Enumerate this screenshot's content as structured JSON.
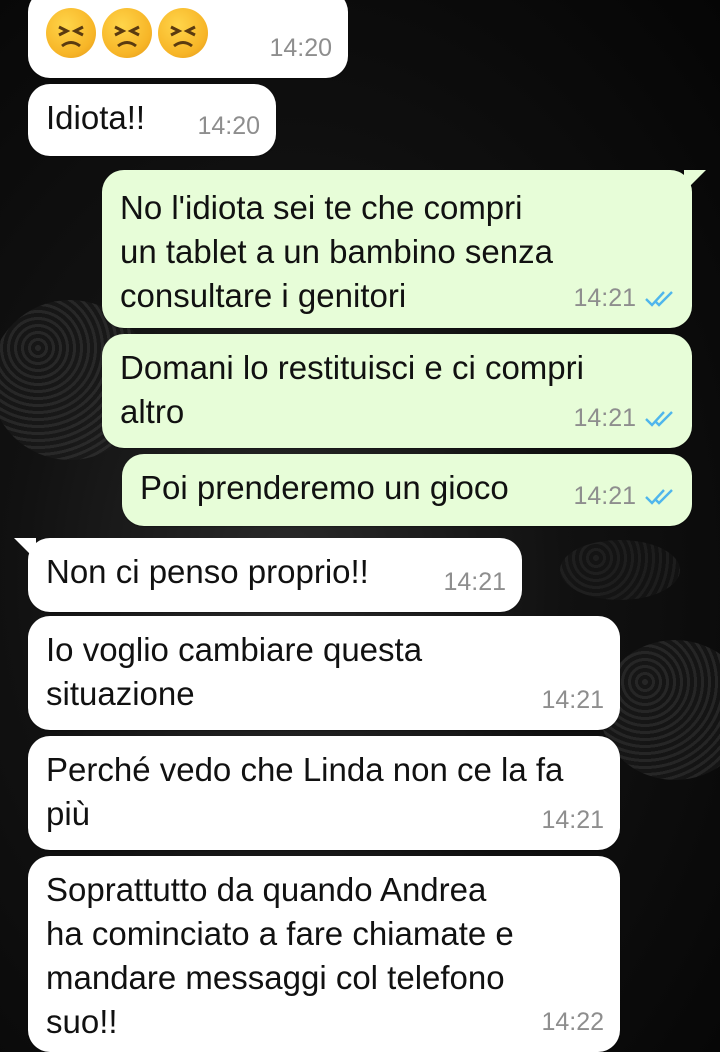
{
  "messages": [
    {
      "id": "m0",
      "direction": "incoming",
      "emoji": [
        "persevering-face",
        "persevering-face",
        "persevering-face"
      ],
      "time": "14:20"
    },
    {
      "id": "m1",
      "direction": "incoming",
      "text": "Idiota!!",
      "time": "14:20"
    },
    {
      "id": "m2",
      "direction": "outgoing",
      "text": "No l'idiota sei te che compri\nun tablet a un bambino senza\nconsultare i genitori",
      "time": "14:21",
      "status": "read"
    },
    {
      "id": "m3",
      "direction": "outgoing",
      "text": "Domani lo restituisci e ci compri\naltro",
      "time": "14:21",
      "status": "read"
    },
    {
      "id": "m4",
      "direction": "outgoing",
      "text": "Poi prenderemo un gioco",
      "time": "14:21",
      "status": "read"
    },
    {
      "id": "m5",
      "direction": "incoming",
      "text": "Non ci penso proprio!!",
      "time": "14:21"
    },
    {
      "id": "m6",
      "direction": "incoming",
      "text": "Io voglio cambiare questa\nsituazione",
      "time": "14:21"
    },
    {
      "id": "m7",
      "direction": "incoming",
      "text": "Perché vedo che Linda non ce la fa\npiù",
      "time": "14:21"
    },
    {
      "id": "m8",
      "direction": "incoming",
      "text": "Soprattutto da quando Andrea\nha cominciato a fare chiamate e\nmandare messaggi col telefono\nsuo!!",
      "time": "14:22"
    }
  ],
  "colors": {
    "incoming_bubble": "#ffffff",
    "outgoing_bubble": "#e7fdd8",
    "read_ticks": "#4fb6ec",
    "timestamp": "#8e8e8e"
  }
}
